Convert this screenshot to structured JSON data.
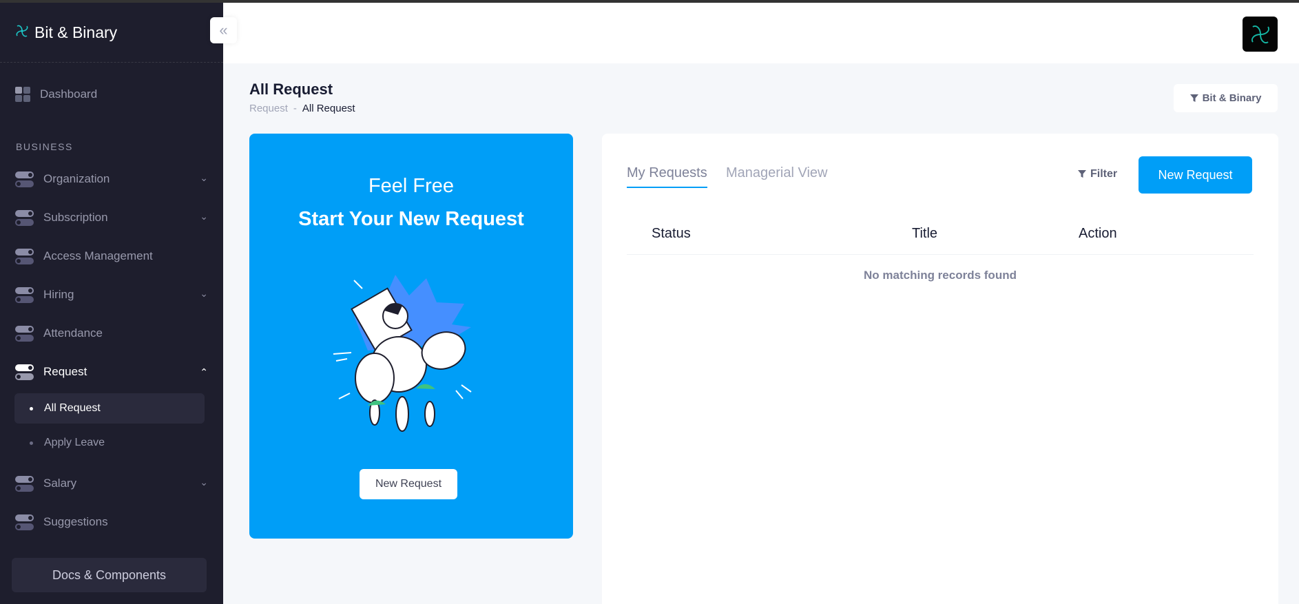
{
  "app": {
    "title": "Bit & Binary"
  },
  "sidebar": {
    "dashboard": "Dashboard",
    "section": "BUSINESS",
    "items": [
      {
        "label": "Organization"
      },
      {
        "label": "Subscription"
      },
      {
        "label": "Access Management"
      },
      {
        "label": "Hiring"
      },
      {
        "label": "Attendance"
      },
      {
        "label": "Request"
      },
      {
        "label": "Salary"
      },
      {
        "label": "Suggestions"
      }
    ],
    "request_sub": [
      {
        "label": "All Request"
      },
      {
        "label": "Apply Leave"
      }
    ],
    "docs": "Docs & Components"
  },
  "toolbar": {
    "title": "All Request",
    "breadcrumb": [
      "Request",
      "-",
      "All Request"
    ],
    "org_button": "Bit & Binary"
  },
  "promo": {
    "line1": "Feel Free",
    "line2": "Start Your New Request",
    "button": "New Request"
  },
  "main": {
    "tabs": [
      {
        "label": "My Requests"
      },
      {
        "label": "Managerial View"
      }
    ],
    "filter": "Filter",
    "new_button": "New Request",
    "columns": [
      "Status",
      "Title",
      "Action"
    ],
    "empty": "No matching records found"
  },
  "colors": {
    "primary": "#009ef7",
    "sidebar_bg": "#1e1e2d",
    "page_bg": "#f5f7fa"
  },
  "icons": {
    "logo": "pinwheel-logo-icon",
    "collapse": "double-chevron-left-icon",
    "dashboard": "grid-icon",
    "menu": "toggle-icon",
    "chevron": "chevron-down-icon",
    "filter": "funnel-icon",
    "avatar": "pinwheel-avatar-icon"
  }
}
